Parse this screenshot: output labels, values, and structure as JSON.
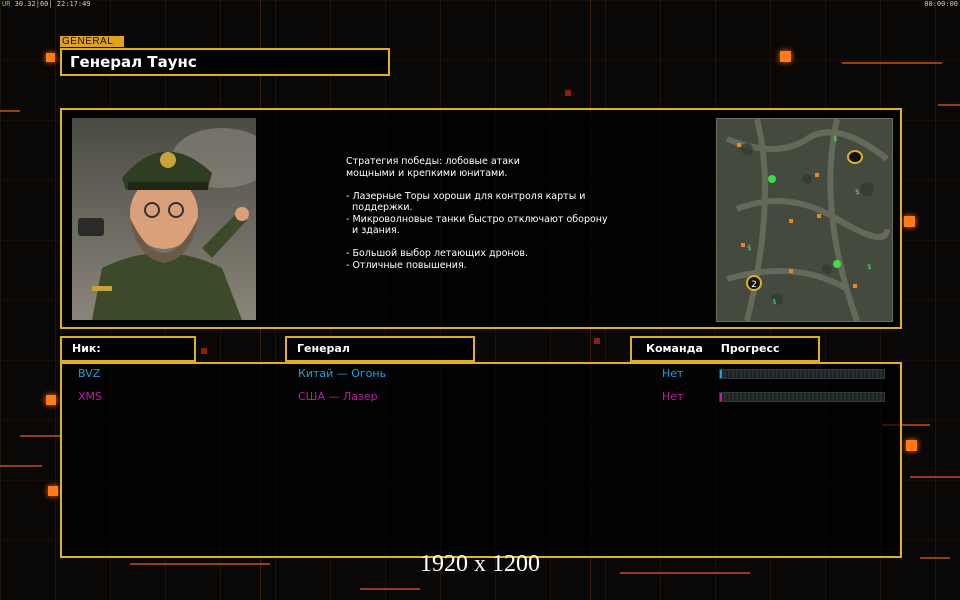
{
  "status_bar": {
    "left_prefix": "UR",
    "left_text": "30.32|60| 22:17:49",
    "right_text": "00:00:00"
  },
  "general": {
    "tag": "GENERAL",
    "name": "Генерал Таунс",
    "description": "Стратегия победы: лобовые атаки\nмощными и крепкими юнитами.\n\n- Лазерные Торы хороши для контроля карты и\n  поддержки.\n- Микроволновые танки быстро отключают оборону\n  и здания.\n\n- Большой выбор летающих дронов.\n- Отличные повышения.",
    "portrait_icon": "general-portrait",
    "minimap_icon": "minimap"
  },
  "table": {
    "headers": {
      "nick": "Ник:",
      "general": "Генерал",
      "team": "Команда",
      "progress": "Прогресс"
    },
    "rows": [
      {
        "nick": "BVZ",
        "general": "Китай — Огонь",
        "team": "Нет",
        "color": "#1aa3d6",
        "progress": 0.01
      },
      {
        "nick": "XMS",
        "general": "США — Лазер",
        "team": "Нет",
        "color": "#c01aa8",
        "progress": 0.01
      }
    ]
  },
  "watermark": "1920 x 1200",
  "colors": {
    "accent": "#e0b020",
    "orange": "#ff7a1a"
  }
}
